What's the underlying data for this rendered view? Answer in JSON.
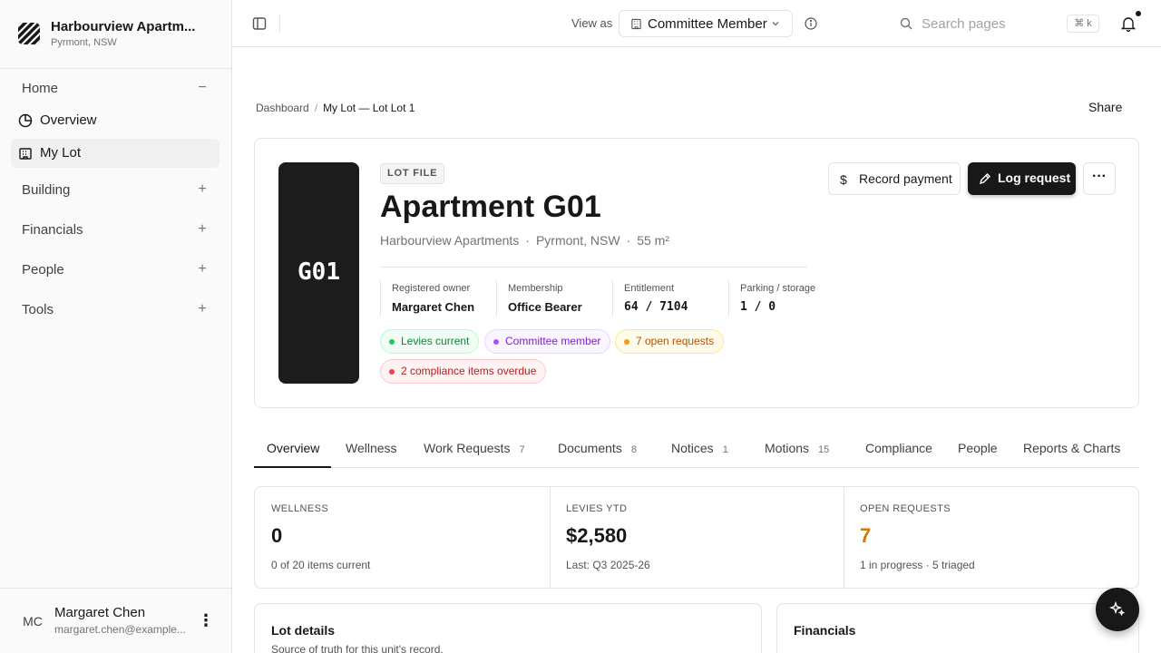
{
  "org": {
    "name": "Harbourview Apartm...",
    "location": "Pyrmont, NSW"
  },
  "nav": {
    "home": "Home",
    "overview": "Overview",
    "my_lot": "My Lot",
    "building": "Building",
    "financials": "Financials",
    "people": "People",
    "tools": "Tools",
    "collapse": "−",
    "expand": "+"
  },
  "user": {
    "initials": "MC",
    "name": "Margaret Chen",
    "email": "margaret.chen@example...",
    "menu": "⋮"
  },
  "topbar": {
    "view_as_label": "View as",
    "role": "Committee Member",
    "search_placeholder": "Search pages",
    "shortcut": "⌘ k"
  },
  "breadcrumb": {
    "root": "Dashboard",
    "sep": "/",
    "current": "My Lot — Lot Lot 1"
  },
  "share": "Share",
  "lot": {
    "tile": "G01",
    "kind": "LOT FILE",
    "title": "Apartment G01",
    "building": "Harbourview Apartments",
    "suburb": "Pyrmont, NSW",
    "area": "55 m²",
    "dot": "·",
    "stats": [
      {
        "key": "Registered owner",
        "value": "Margaret Chen"
      },
      {
        "key": "Membership",
        "value": "Office Bearer"
      },
      {
        "key": "Entitlement",
        "value": "64 / 7104"
      },
      {
        "key": "Parking / storage",
        "value": "1 / 0"
      }
    ],
    "badges": {
      "levies": "Levies current",
      "committee": "Committee member",
      "requests": "7 open requests",
      "compliance": "2 compliance items overdue"
    },
    "actions": {
      "record_payment": "Record payment",
      "log_request": "Log request",
      "more": "···",
      "dollar": "$"
    }
  },
  "tabs": [
    {
      "label": "Overview",
      "count": ""
    },
    {
      "label": "Wellness",
      "count": ""
    },
    {
      "label": "Work Requests",
      "count": "7"
    },
    {
      "label": "Documents",
      "count": "8"
    },
    {
      "label": "Notices",
      "count": "1"
    },
    {
      "label": "Motions",
      "count": "15"
    },
    {
      "label": "Compliance",
      "count": ""
    },
    {
      "label": "People",
      "count": ""
    },
    {
      "label": "Reports & Charts",
      "count": ""
    }
  ],
  "kpis": [
    {
      "title": "WELLNESS",
      "value": "0",
      "sub": "0 of 20 items current"
    },
    {
      "title": "LEVIES YTD",
      "value": "$2,580",
      "sub": "Last: Q3 2025-26"
    },
    {
      "title": "OPEN REQUESTS",
      "value": "7",
      "sub": "1 in progress · 5 triaged"
    }
  ],
  "cards": {
    "lot_details": {
      "title": "Lot details",
      "sub": "Source of truth for this unit's record."
    },
    "financials": {
      "title": "Financials"
    }
  },
  "colors": {
    "accent": "#18181b",
    "warning_value": "#d97706"
  }
}
